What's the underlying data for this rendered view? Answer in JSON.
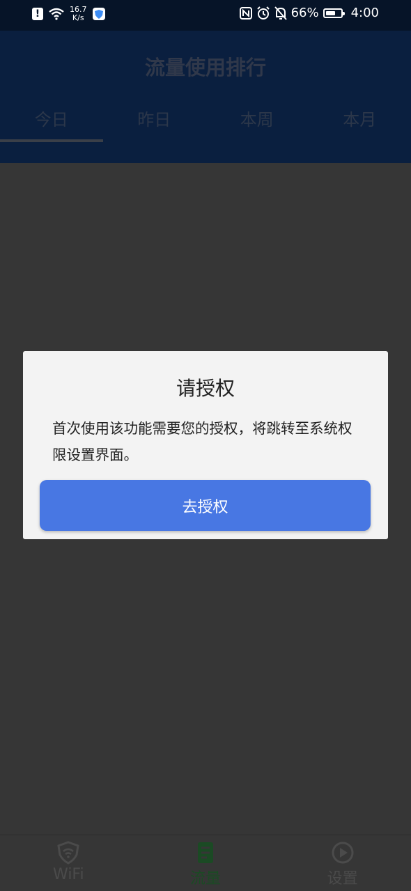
{
  "status_bar": {
    "net_speed_value": "16.7",
    "net_speed_unit": "K/s",
    "battery_percent": "66%",
    "battery_level": 0.66,
    "time": "4:00",
    "icons": [
      "alert-icon",
      "wifi-icon",
      "shield-icon",
      "nfc-icon",
      "alarm-icon",
      "mute-bell-icon",
      "battery-icon"
    ]
  },
  "header": {
    "title": "流量使用排行",
    "tabs": [
      {
        "label": "今日",
        "active": true
      },
      {
        "label": "昨日",
        "active": false
      },
      {
        "label": "本周",
        "active": false
      },
      {
        "label": "本月",
        "active": false
      }
    ]
  },
  "dialog": {
    "title": "请授权",
    "message": "首次使用该功能需要您的授权，将跳转至系统权限设置界面。",
    "button_label": "去授权"
  },
  "bottom_nav": {
    "items": [
      {
        "label": "WiFi",
        "icon": "wifi-shield-icon",
        "active": false
      },
      {
        "label": "流量",
        "icon": "document-icon",
        "active": true
      },
      {
        "label": "设置",
        "icon": "play-circle-icon",
        "active": false
      }
    ]
  },
  "colors": {
    "overlay_bg": "#363636",
    "header_bg": "#0a1f3f",
    "dialog_bg": "#f3f3f3",
    "button_bg": "#4877e3",
    "active_nav": "#1b4a24"
  }
}
